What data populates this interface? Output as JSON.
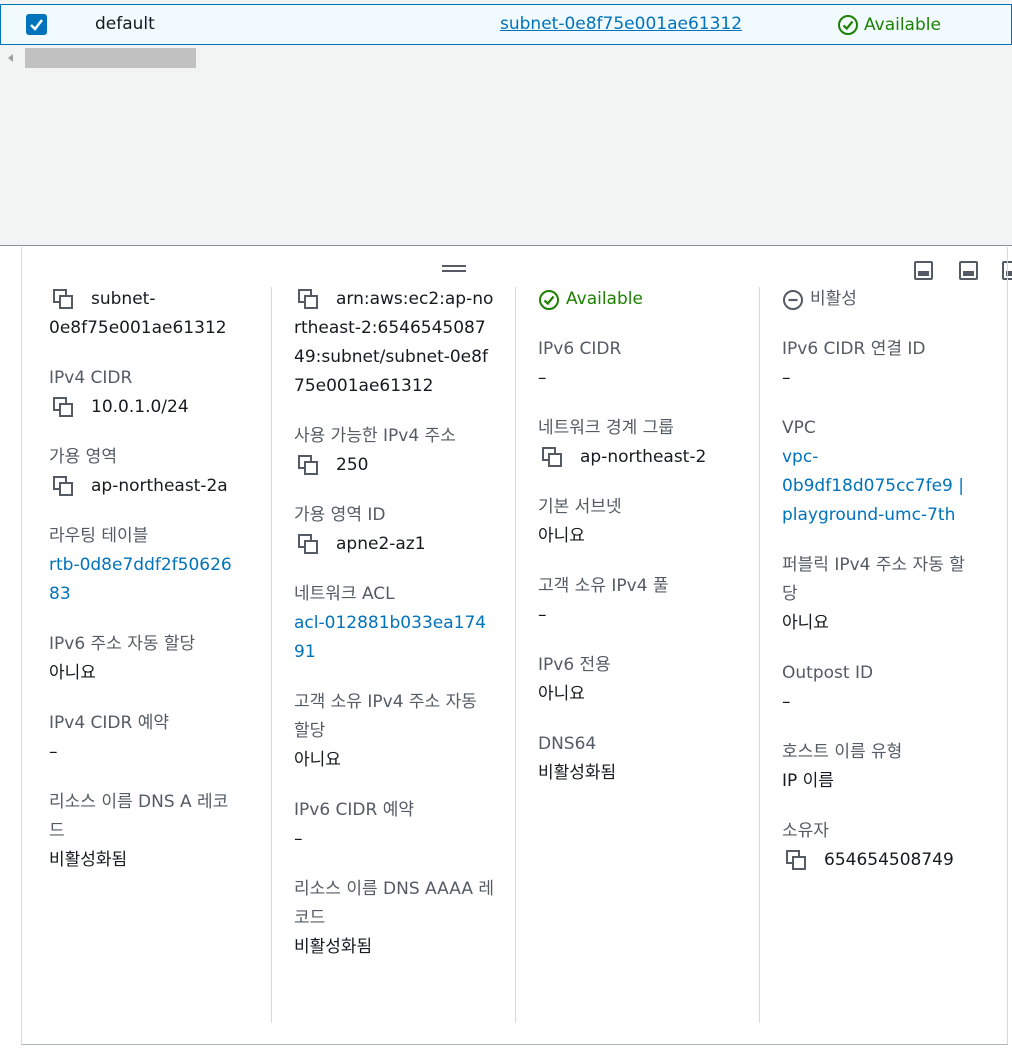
{
  "table": {
    "row": {
      "name": "default",
      "subnet_id": "subnet-0e8f75e001ae61312",
      "status": "Available",
      "checked": true
    }
  },
  "details": {
    "col1": {
      "subnet_id": "subnet-0e8f75e001ae61312",
      "ipv4_cidr_label": "IPv4 CIDR",
      "ipv4_cidr": "10.0.1.0/24",
      "az_label": "가용 영역",
      "az": "ap-northeast-2a",
      "route_table_label": "라우팅 테이블",
      "route_table": "rtb-0d8e7ddf2f5062683",
      "ipv6_auto_label": "IPv6 주소 자동 할당",
      "ipv6_auto": "아니요",
      "ipv4_reserve_label": "IPv4 CIDR 예약",
      "ipv4_reserve": "–",
      "dns_a_label": "리소스 이름 DNS A 레코드",
      "dns_a": "비활성화됨"
    },
    "col2": {
      "arn": "arn:aws:ec2:ap-northeast-2:654654508749:subnet/subnet-0e8f75e001ae61312",
      "avail_ipv4_label": "사용 가능한 IPv4 주소",
      "avail_ipv4": "250",
      "az_id_label": "가용 영역 ID",
      "az_id": "apne2-az1",
      "acl_label": "네트워크 ACL",
      "acl": "acl-012881b033ea17491",
      "cust_ipv4_auto_label": "고객 소유 IPv4 주소 자동 할당",
      "cust_ipv4_auto": "아니요",
      "ipv6_reserve_label": "IPv6 CIDR 예약",
      "ipv6_reserve": "–",
      "dns_aaaa_label": "리소스 이름 DNS AAAA 레코드",
      "dns_aaaa": "비활성화됨"
    },
    "col3": {
      "state": "Available",
      "ipv6_cidr_label": "IPv6 CIDR",
      "ipv6_cidr": "–",
      "border_group_label": "네트워크 경계 그룹",
      "border_group": "ap-northeast-2",
      "default_subnet_label": "기본 서브넷",
      "default_subnet": "아니요",
      "cust_pool_label": "고객 소유 IPv4 풀",
      "cust_pool": "–",
      "ipv6_only_label": "IPv6 전용",
      "ipv6_only": "아니요",
      "dns64_label": "DNS64",
      "dns64": "비활성화됨"
    },
    "col4": {
      "state_off": "비활성",
      "ipv6_assoc_label": "IPv6 CIDR 연결 ID",
      "ipv6_assoc": "–",
      "vpc_label": "VPC",
      "vpc": "vpc-0b9df18d075cc7fe9 | playground-umc-7th",
      "public_ipv4_label": "퍼블릭 IPv4 주소 자동 할당",
      "public_ipv4": "아니요",
      "outpost_label": "Outpost ID",
      "outpost": "–",
      "hostname_type_label": "호스트 이름 유형",
      "hostname_type": "IP 이름",
      "owner_label": "소유자",
      "owner": "654654508749"
    }
  },
  "colors": {
    "link": "#0073bb",
    "success": "#1d8102",
    "label": "#545b64",
    "selected_row_bg": "#f1faff"
  }
}
